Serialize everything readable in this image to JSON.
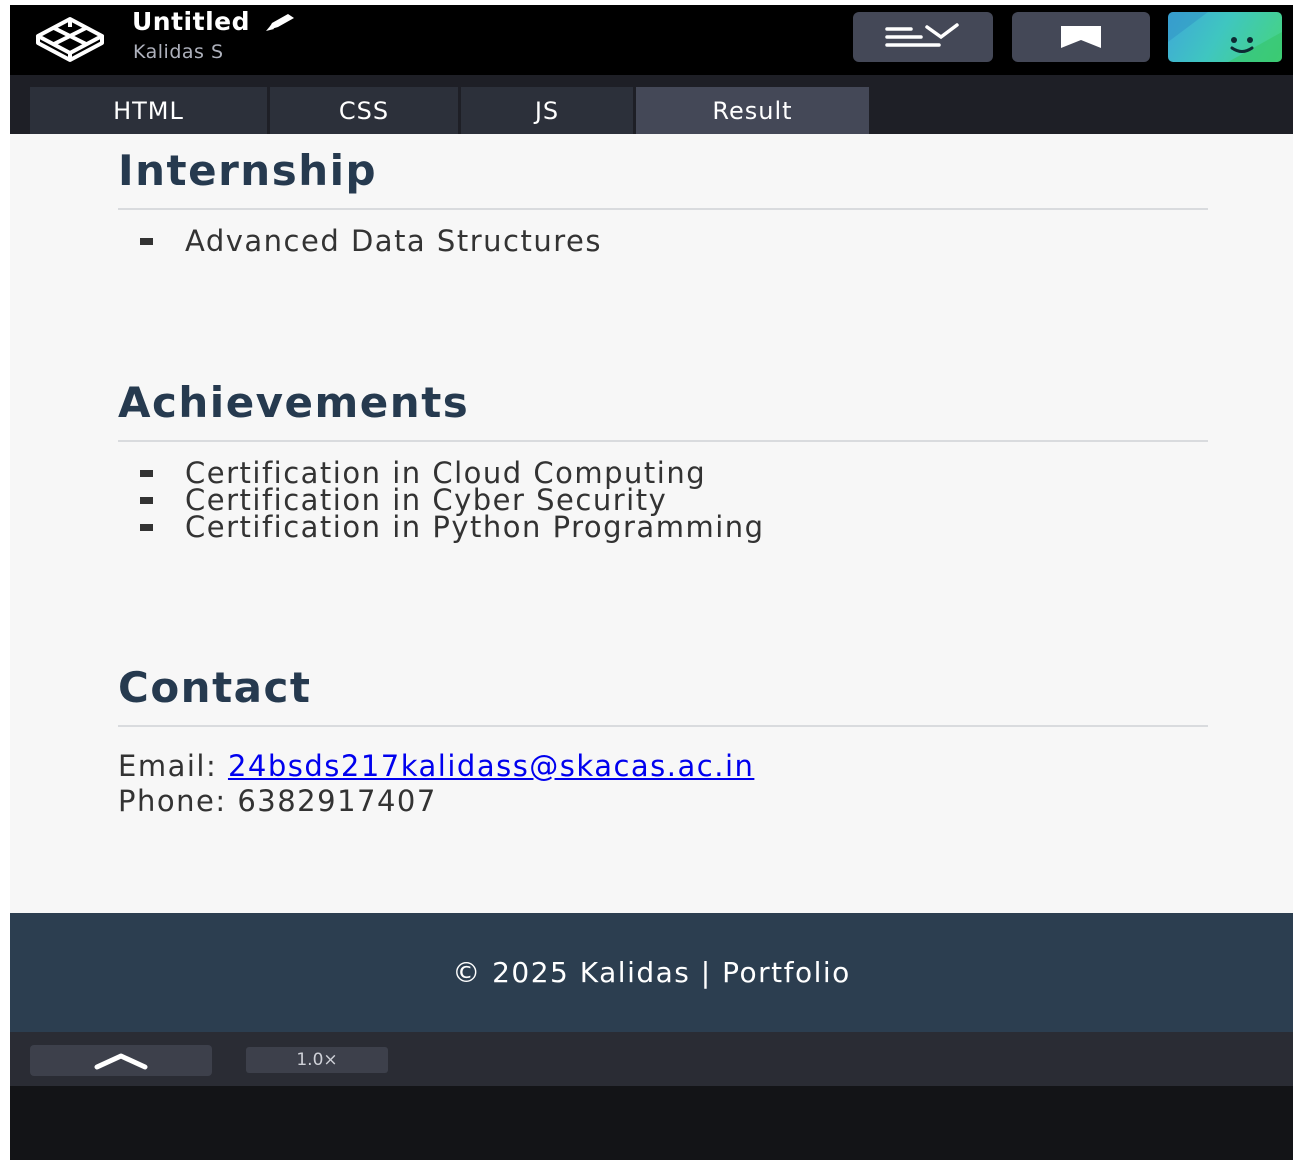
{
  "header": {
    "title": "Untitled",
    "owner": "Kalidas S",
    "icons": {
      "logo": "codepen-cube-icon",
      "edit": "pencil-icon",
      "layout": "layout-menu-icon",
      "save": "bookmark-icon",
      "avatar": "user-avatar"
    }
  },
  "tabs": [
    {
      "label": "HTML"
    },
    {
      "label": "CSS"
    },
    {
      "label": "JS"
    },
    {
      "label": "Result",
      "active": true
    }
  ],
  "result": {
    "internship": {
      "heading": "Internship",
      "items": [
        "Advanced Data Structures"
      ]
    },
    "achievements": {
      "heading": "Achievements",
      "items": [
        "Certification in Cloud Computing",
        "Certification in Cyber Security",
        "Certification in Python Programming"
      ]
    },
    "contact": {
      "heading": "Contact",
      "email_label": "Email:",
      "email": "24bsds217kalidass@skacas.ac.in",
      "phone_label": "Phone:",
      "phone": "6382917407"
    },
    "footer": "© 2025 Kalidas | Portfolio"
  },
  "bottombar": {
    "zoom": "1.0×"
  },
  "colors": {
    "heading": "#263a4f",
    "footer_bg": "#2c3e50",
    "link": "#0000ee",
    "active_tab": "#444857"
  }
}
